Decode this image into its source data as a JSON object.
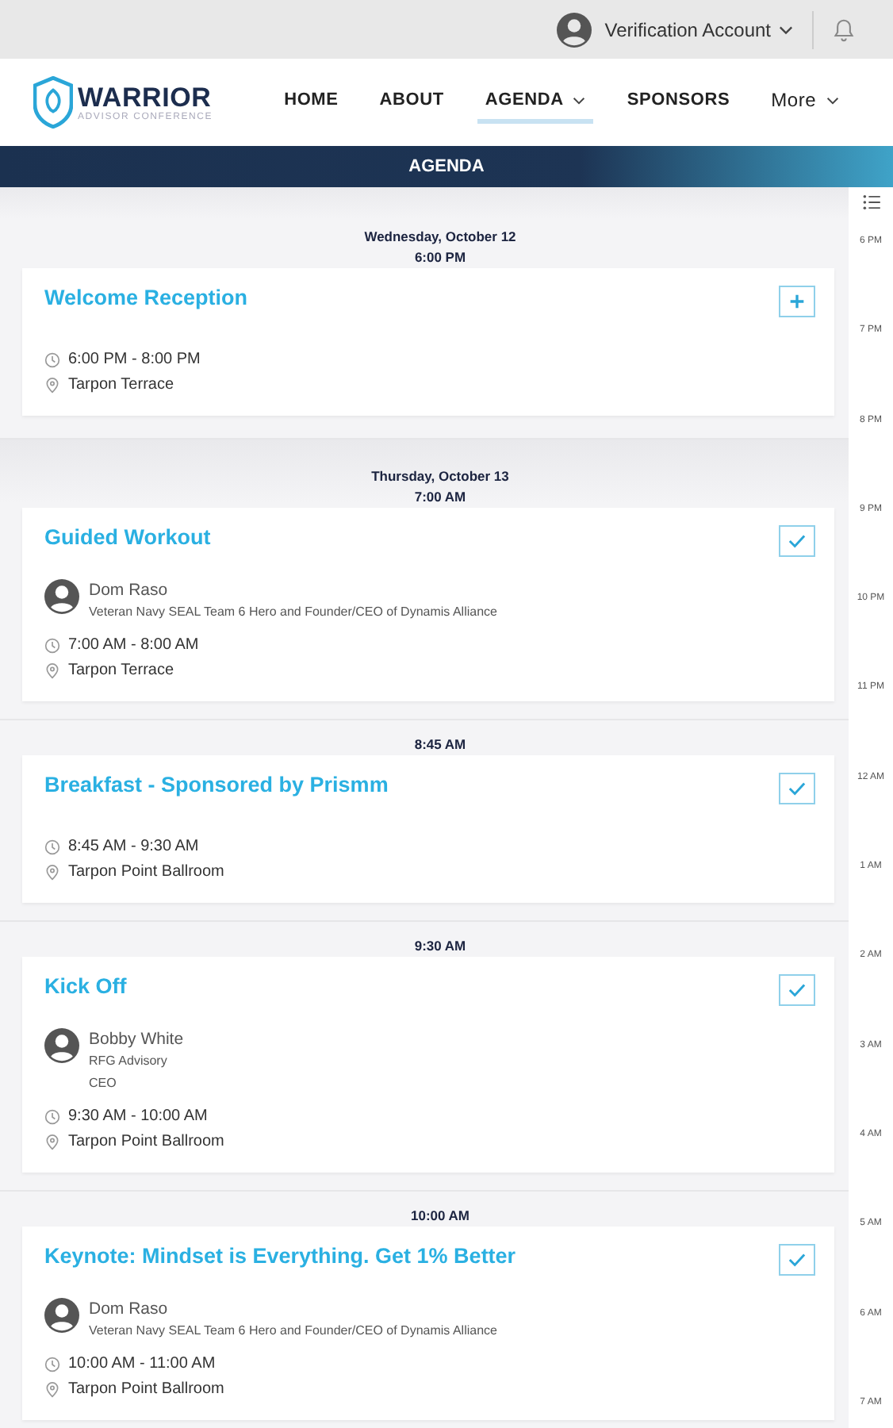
{
  "account": {
    "name": "Verification Account"
  },
  "logo": {
    "name": "WARRIOR",
    "tagline": "ADVISOR CONFERENCE"
  },
  "nav": [
    {
      "label": "HOME",
      "selected": false,
      "dropdown": false
    },
    {
      "label": "ABOUT",
      "selected": false,
      "dropdown": false
    },
    {
      "label": "AGENDA",
      "selected": true,
      "dropdown": true
    },
    {
      "label": "SPONSORS",
      "selected": false,
      "dropdown": false
    },
    {
      "label": "More",
      "selected": false,
      "dropdown": true
    }
  ],
  "banner": {
    "title": "AGENDA"
  },
  "sessions": [
    {
      "day": "Wednesday, October 12",
      "start": "6:00 PM",
      "title": "Welcome Reception",
      "added": false,
      "time": "6:00 PM - 8:00 PM",
      "location": "Tarpon Terrace"
    },
    {
      "day": "Thursday, October 13",
      "start": "7:00 AM",
      "title": "Guided Workout",
      "added": true,
      "speaker": {
        "name": "Dom Raso",
        "lines": [
          "Veteran Navy SEAL Team 6 Hero and Founder/CEO of Dynamis Alliance"
        ]
      },
      "time": "7:00 AM - 8:00 AM",
      "location": "Tarpon Terrace"
    },
    {
      "start": "8:45 AM",
      "title": "Breakfast - Sponsored by Prismm",
      "added": true,
      "time": "8:45 AM - 9:30 AM",
      "location": "Tarpon Point Ballroom"
    },
    {
      "start": "9:30 AM",
      "title": "Kick Off",
      "added": true,
      "speaker": {
        "name": "Bobby White",
        "lines": [
          "RFG Advisory",
          "CEO"
        ]
      },
      "time": "9:30 AM - 10:00 AM",
      "location": "Tarpon Point Ballroom"
    },
    {
      "start": "10:00 AM",
      "title": "Keynote: Mindset is Everything. Get 1% Better",
      "added": true,
      "speaker": {
        "name": "Dom Raso",
        "lines": [
          "Veteran Navy SEAL Team 6 Hero and Founder/CEO of Dynamis Alliance"
        ]
      },
      "time": "10:00 AM - 11:00 AM",
      "location": "Tarpon Point Ballroom"
    }
  ],
  "timeline": [
    "6 PM",
    "7 PM",
    "8 PM",
    "9 PM",
    "10 PM",
    "11 PM",
    "12 AM",
    "1 AM",
    "2 AM",
    "3 AM",
    "4 AM",
    "5 AM",
    "6 AM",
    "7 AM"
  ]
}
